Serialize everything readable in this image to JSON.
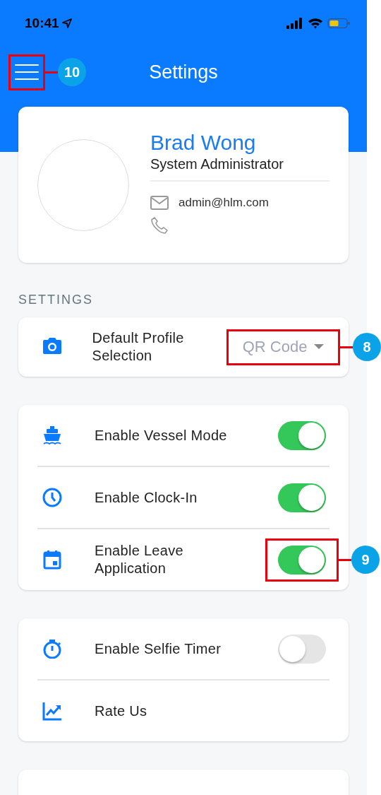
{
  "status_bar": {
    "time": "10:41"
  },
  "header": {
    "title": "Settings",
    "callout": "10"
  },
  "profile": {
    "name": "Brad Wong",
    "role": "System Administrator",
    "email": "admin@hlm.com"
  },
  "section_label": "SETTINGS",
  "groups": [
    [
      {
        "kind": "select",
        "label": "Default Profile Selection",
        "value": "QR Code",
        "callout": "8"
      }
    ],
    [
      {
        "kind": "toggle",
        "label": "Enable Vessel Mode",
        "on": true
      },
      {
        "kind": "toggle",
        "label": "Enable Clock-In",
        "on": true
      },
      {
        "kind": "toggle",
        "label": "Enable Leave Application",
        "on": true,
        "callout": "9"
      }
    ],
    [
      {
        "kind": "toggle",
        "label": "Enable Selfie Timer",
        "on": false
      },
      {
        "kind": "link",
        "label": "Rate Us"
      }
    ]
  ]
}
